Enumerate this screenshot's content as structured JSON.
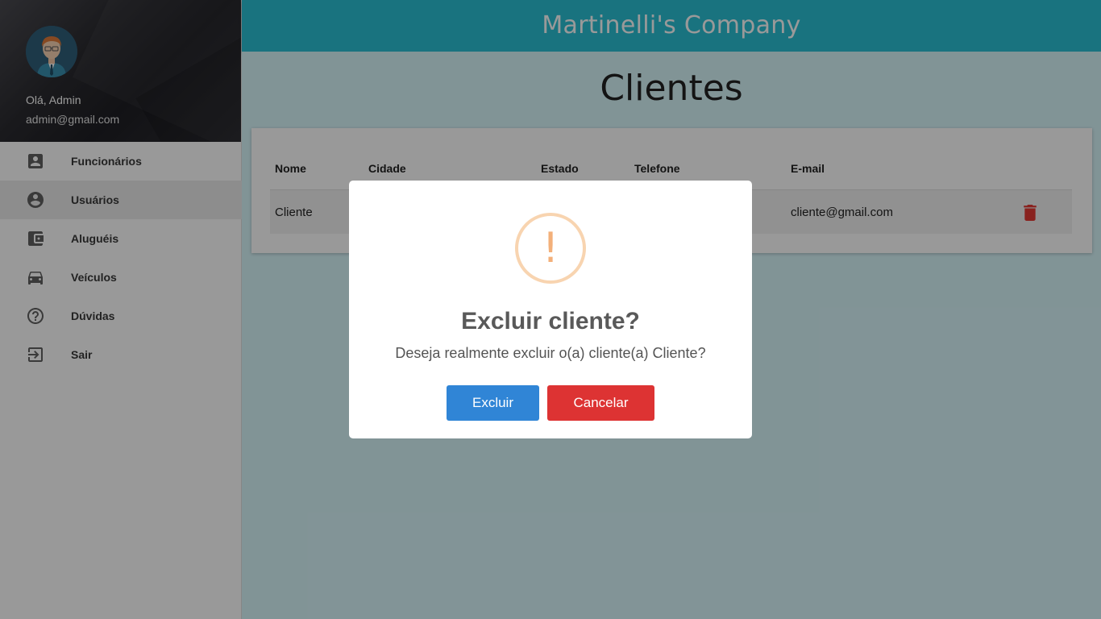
{
  "sidebar": {
    "greeting": "Olá, Admin",
    "email": "admin@gmail.com",
    "items": [
      {
        "label": "Funcionários",
        "icon": "contact-card-icon",
        "active": false
      },
      {
        "label": "Usuários",
        "icon": "account-circle-icon",
        "active": true
      },
      {
        "label": "Aluguéis",
        "icon": "wallet-icon",
        "active": false
      },
      {
        "label": "Veículos",
        "icon": "car-icon",
        "active": false
      },
      {
        "label": "Dúvidas",
        "icon": "help-circle-icon",
        "active": false
      },
      {
        "label": "Sair",
        "icon": "exit-icon",
        "active": false
      }
    ]
  },
  "header": {
    "company": "Martinelli's Company"
  },
  "main": {
    "title": "Clientes",
    "table": {
      "columns": [
        "Nome",
        "Cidade",
        "Estado",
        "Telefone",
        "E-mail"
      ],
      "rows": [
        {
          "nome": "Cliente",
          "email": "cliente@gmail.com"
        }
      ]
    }
  },
  "dialog": {
    "icon_mark": "!",
    "title": "Excluir cliente?",
    "message": "Deseja realmente excluir o(a) cliente(a) Cliente?",
    "confirm_label": "Excluir",
    "cancel_label": "Cancelar"
  },
  "colors": {
    "header": "#2bc0d4",
    "confirm": "#3085d6",
    "cancel": "#dd3333",
    "warning": "#f8bb86",
    "trash": "#e53935"
  }
}
